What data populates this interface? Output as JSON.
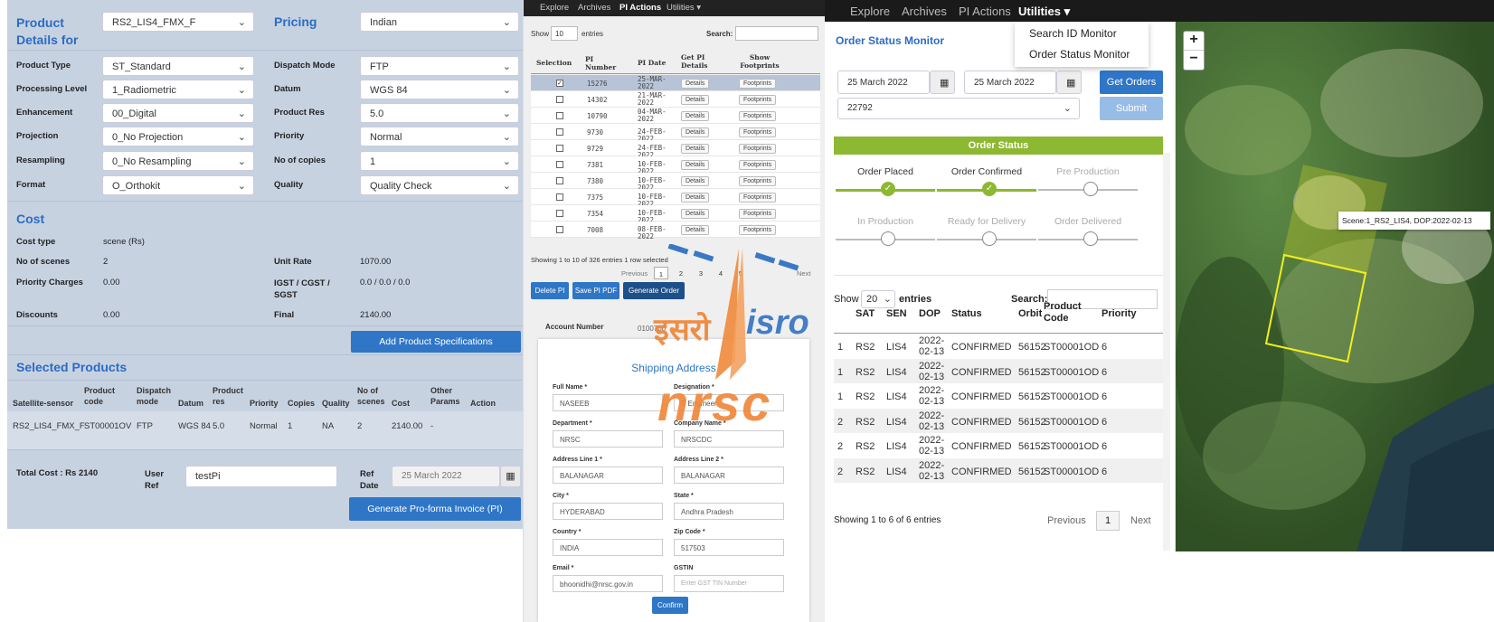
{
  "left_panel": {
    "product_details_title": "Product",
    "product_details_title2": "Details for",
    "product_select": "RS2_LIS4_FMX_F",
    "pricing_title": "Pricing",
    "pricing_select": "Indian",
    "left_fields": [
      {
        "label": "Product Type",
        "value": "ST_Standard"
      },
      {
        "label": "Processing Level",
        "value": "1_Radiometric"
      },
      {
        "label": "Enhancement",
        "value": "00_Digital"
      },
      {
        "label": "Projection",
        "value": "0_No Projection"
      },
      {
        "label": "Resampling",
        "value": "0_No Resampling"
      },
      {
        "label": "Format",
        "value": "O_Orthokit"
      }
    ],
    "right_fields": [
      {
        "label": "Dispatch Mode",
        "value": "FTP"
      },
      {
        "label": "Datum",
        "value": "WGS 84"
      },
      {
        "label": "Product Res",
        "value": "5.0"
      },
      {
        "label": "Priority",
        "value": "Normal"
      },
      {
        "label": "No of copies",
        "value": "1"
      },
      {
        "label": "Quality",
        "value": "Quality Check"
      }
    ],
    "cost_title": "Cost",
    "cost_type_label": "Cost type",
    "cost_type_value": "scene (Rs)",
    "no_scenes_label": "No of scenes",
    "no_scenes_value": "2",
    "unit_rate_label": "Unit Rate",
    "unit_rate_value": "1070.00",
    "priority_charges_label": "Priority Charges",
    "priority_charges_value": "0.00",
    "igst_label": "IGST / CGST /",
    "igst_label2": "SGST",
    "igst_value": "0.0 / 0.0 / 0.0",
    "discounts_label": "Discounts",
    "discounts_value": "0.00",
    "final_label": "Final",
    "final_value": "2140.00",
    "add_spec_button": "Add Product Specifications",
    "selected_title": "Selected Products",
    "table_headers": [
      "Satellite-sensor",
      "Product code",
      "Dispatch mode",
      "Datum",
      "Product res",
      "Priority",
      "Copies",
      "Quality",
      "No of scenes",
      "Cost",
      "Other Params",
      "Action"
    ],
    "table_row": [
      "RS2_LIS4_FMX_F",
      "ST00001OV",
      "FTP",
      "WGS 84",
      "5.0",
      "Normal",
      "1",
      "NA",
      "2",
      "2140.00",
      "-",
      ""
    ],
    "total_cost": "Total Cost : Rs 2140",
    "user_ref_label": "User Ref",
    "user_ref_value": "testPi",
    "ref_date_label": "Ref Date",
    "ref_date_value": "25 March 2022",
    "generate_pi_button": "Generate Pro-forma Invoice (PI)"
  },
  "mid_panel": {
    "nav": [
      "Explore",
      "Archives",
      "PI Actions",
      "Utilities ▾"
    ],
    "show_label": "Show",
    "show_value": "10",
    "entries_label": "entries",
    "search_label": "Search:",
    "headers": [
      "Selection",
      "PI Number",
      "PI Date",
      "Get PI Details",
      "Show Footprints"
    ],
    "rows": [
      {
        "num": "15276",
        "date": "25-MAR-2022"
      },
      {
        "num": "14302",
        "date": "21-MAR-2022"
      },
      {
        "num": "10790",
        "date": "04-MAR-2022"
      },
      {
        "num": "9730",
        "date": "24-FEB-2022"
      },
      {
        "num": "9729",
        "date": "24-FEB-2022"
      },
      {
        "num": "7381",
        "date": "10-FEB-2022"
      },
      {
        "num": "7380",
        "date": "10-FEB-2022"
      },
      {
        "num": "7375",
        "date": "10-FEB-2022"
      },
      {
        "num": "7354",
        "date": "10-FEB-2022"
      },
      {
        "num": "7008",
        "date": "08-FEB-2022"
      }
    ],
    "details_btn": "Details",
    "footprints_btn": "Footprints",
    "showing": "Showing 1 to 10 of 326 entries   1 row selected",
    "previous": "Previous",
    "pages": [
      "1",
      "2",
      "3",
      "4",
      "5"
    ],
    "next": "Next",
    "delete_pi": "Delete PI",
    "save_pdf": "Save PI PDF",
    "generate_order": "Generate Order",
    "account_number_label": "Account Number",
    "account_number_value": "0100700",
    "shipping_title": "Shipping Address",
    "fields": [
      {
        "label": "Full Name *",
        "value": "NASEEB"
      },
      {
        "label": "Designation *",
        "value": "S Engineer"
      },
      {
        "label": "Department *",
        "value": "NRSC"
      },
      {
        "label": "Company Name *",
        "value": "NRSCDC"
      },
      {
        "label": "Address Line 1 *",
        "value": "BALANAGAR"
      },
      {
        "label": "Address Line 2 *",
        "value": "BALANAGAR"
      },
      {
        "label": "City *",
        "value": "HYDERABAD"
      },
      {
        "label": "State *",
        "value": "Andhra Pradesh"
      },
      {
        "label": "Country *",
        "value": "INDIA"
      },
      {
        "label": "Zip Code *",
        "value": "517503"
      },
      {
        "label": "Email *",
        "value": "bhoonidhi@nrsc.gov.in"
      },
      {
        "label": "GSTIN",
        "value": "Enter GST TIN Number"
      }
    ],
    "confirm": "Confirm",
    "logo_hindi": "इसरो",
    "logo_isro": "isro",
    "logo_nrsc": "nrsc"
  },
  "right_panel": {
    "nav": [
      "Explore",
      "Archives",
      "PI Actions",
      "Utilities ▾"
    ],
    "dropdown": [
      "Search ID Monitor",
      "Order Status Monitor"
    ],
    "title": "Order Status Monitor",
    "from_date": "25 March 2022",
    "to_date": "25 March 2022",
    "get_orders": "Get Orders",
    "order_id": "22792",
    "submit": "Submit",
    "order_status_header": "Order Status",
    "steps": [
      "Order Placed",
      "Order Confirmed",
      "Pre Production",
      "In Production",
      "Ready for Delivery",
      "Order Delivered"
    ],
    "show_label": "Show",
    "show_value": "20",
    "entries_label": "entries",
    "search_label": "Search:",
    "headers": [
      "",
      "SAT",
      "SEN",
      "DOP",
      "Status",
      "Orbit",
      "Product Code",
      "Priority"
    ],
    "rows": [
      [
        "1",
        "RS2",
        "LIS4",
        "2022-02-13",
        "CONFIRMED",
        "56152",
        "ST00001OD",
        "6"
      ],
      [
        "1",
        "RS2",
        "LIS4",
        "2022-02-13",
        "CONFIRMED",
        "56152",
        "ST00001OD",
        "6"
      ],
      [
        "1",
        "RS2",
        "LIS4",
        "2022-02-13",
        "CONFIRMED",
        "56152",
        "ST00001OD",
        "6"
      ],
      [
        "2",
        "RS2",
        "LIS4",
        "2022-02-13",
        "CONFIRMED",
        "56152",
        "ST00001OD",
        "6"
      ],
      [
        "2",
        "RS2",
        "LIS4",
        "2022-02-13",
        "CONFIRMED",
        "56152",
        "ST00001OD",
        "6"
      ],
      [
        "2",
        "RS2",
        "LIS4",
        "2022-02-13",
        "CONFIRMED",
        "56152",
        "ST00001OD",
        "6"
      ]
    ],
    "showing": "Showing 1 to 6 of 6 entries",
    "previous": "Previous",
    "page": "1",
    "next": "Next"
  },
  "map": {
    "zoom_in": "+",
    "zoom_out": "−",
    "tooltip": "Scene:1_RS2_LIS4, DOP:2022-02-13"
  },
  "colors": {
    "accent": "#2f76c7",
    "green": "#8db831",
    "footprint": "#f2ee1e"
  }
}
